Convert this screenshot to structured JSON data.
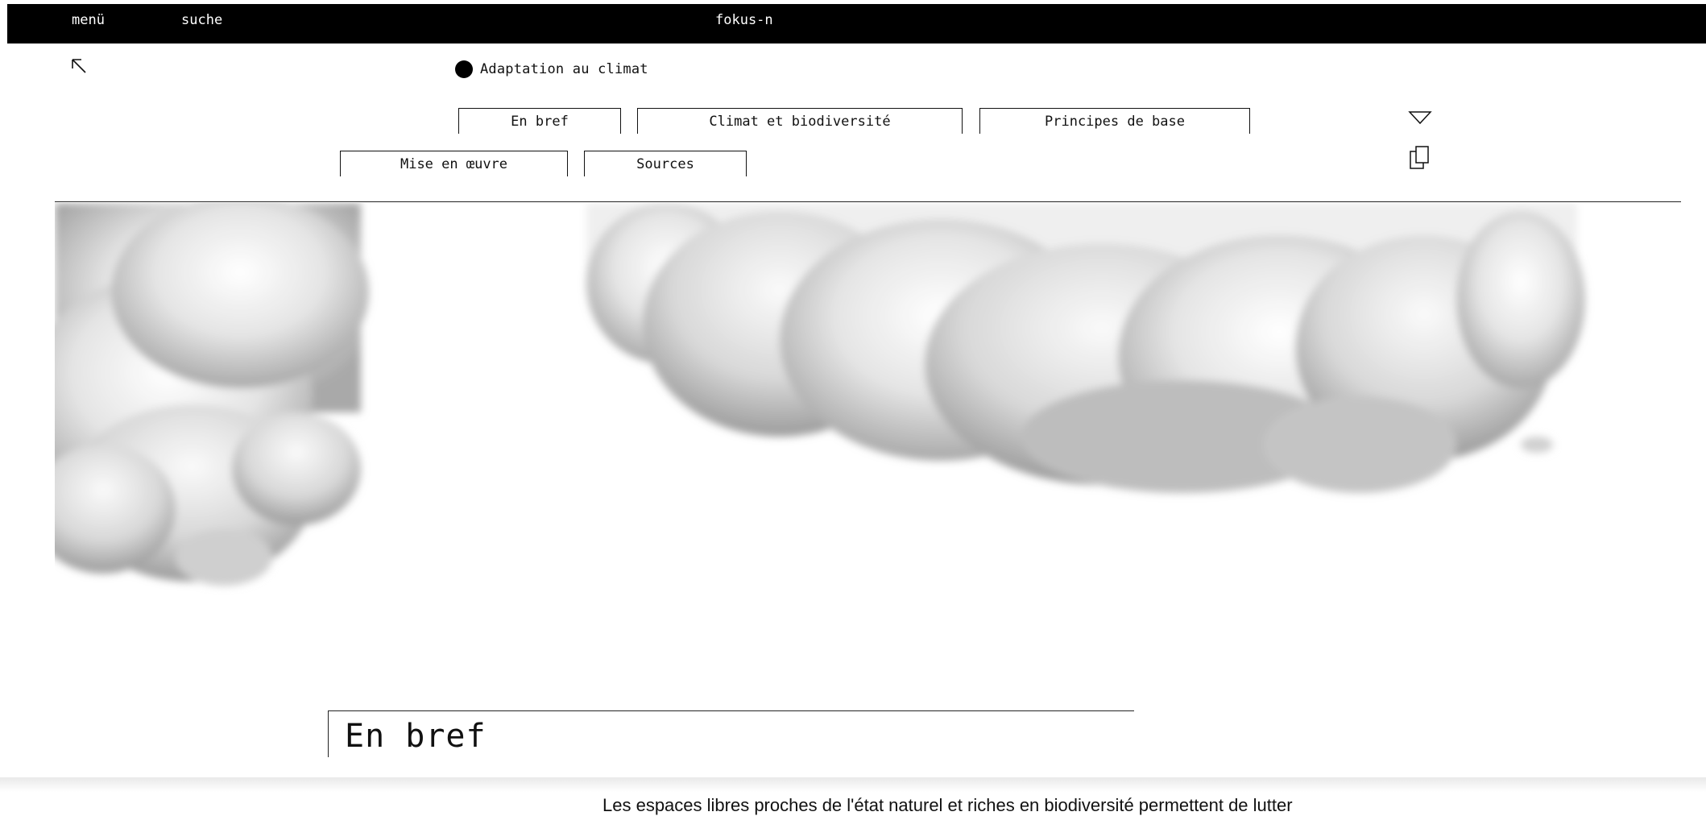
{
  "topbar": {
    "menu_label": "menü",
    "search_label": "suche",
    "site_title": "fokus-n"
  },
  "topic": {
    "label": "Adaptation au climat"
  },
  "tabs": [
    {
      "label": "En bref"
    },
    {
      "label": "Climat et biodiversité"
    },
    {
      "label": "Principes de base"
    },
    {
      "label": "Mise en œuvre"
    },
    {
      "label": "Sources"
    }
  ],
  "icons": {
    "back": "arrow-up-left-icon",
    "dropdown": "triangle-down-icon",
    "copy": "copy-icon"
  },
  "section": {
    "title": "En bref"
  },
  "intro": {
    "text": "Les espaces libres proches de l'état naturel et riches en biodiversité permettent de lutter"
  },
  "colors": {
    "topbar_bg": "#000000",
    "text": "#111111",
    "background": "#ffffff"
  }
}
